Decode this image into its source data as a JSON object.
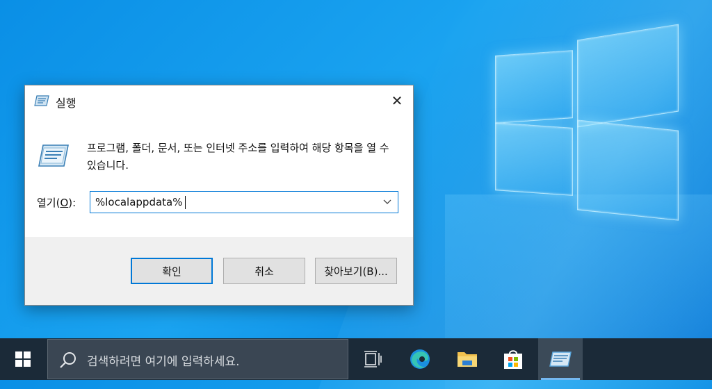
{
  "dialog": {
    "title": "실행",
    "close_label": "✕",
    "description": "프로그램, 폴더, 문서, 또는 인터넷 주소를 입력하여 해당 항목을 열 수 있습니다.",
    "open_label_prefix": "열기(",
    "open_label_key": "O",
    "open_label_suffix": "):",
    "open_value": "%localappdata%",
    "buttons": {
      "ok": "확인",
      "cancel": "취소",
      "browse": "찾아보기(B)..."
    }
  },
  "taskbar": {
    "search_placeholder": "검색하려면 여기에 입력하세요.",
    "items": [
      "task-view",
      "edge",
      "file-explorer",
      "microsoft-store",
      "run"
    ],
    "active_item": "run"
  },
  "colors": {
    "accent": "#0078d7",
    "taskbar": "#1b2a38",
    "desktop": "#1aa3f0"
  }
}
